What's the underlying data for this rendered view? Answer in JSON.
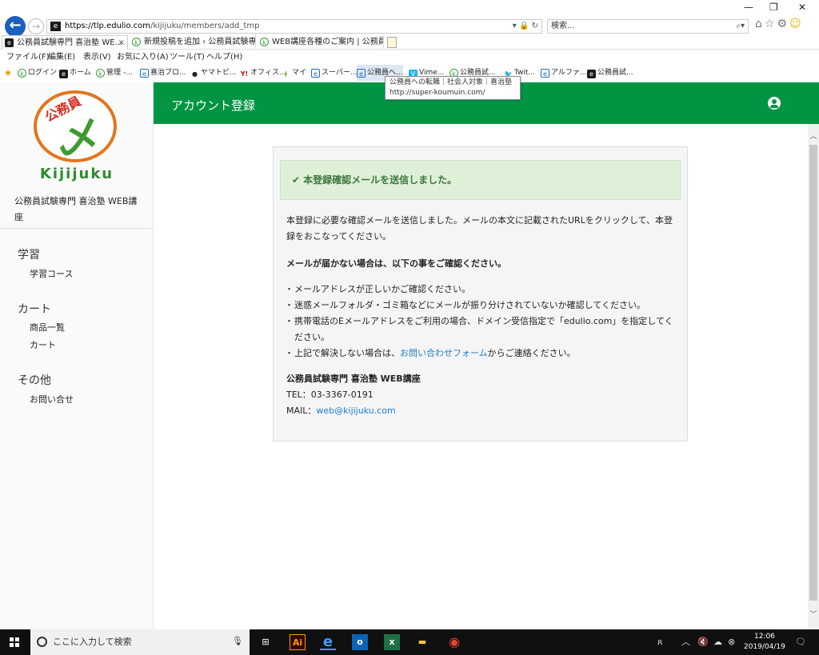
{
  "browser": {
    "url_host": "https://tlp.edulio.com",
    "url_path": "/kijijuku/members/add_tmp",
    "search_placeholder": "検索...",
    "tabs": [
      {
        "label": "公務員試験専門 喜治塾 WE...",
        "close": "×"
      },
      {
        "label": "新規投稿を追加 ‹ 公務員試験専..."
      },
      {
        "label": "WEB講座各種のご案内 | 公務員..."
      }
    ],
    "menu": [
      "ファイル(F)",
      "編集(E)",
      "表示(V)",
      "お気に入り(A)",
      "ツール(T)",
      "ヘルプ(H)"
    ],
    "favorites": [
      "ログイン",
      "ホーム",
      "管理 -...",
      "喜治ブロ...",
      "ヤマトビ...",
      "オフィス...",
      "マイ",
      "スーパー...",
      "公務員へ...",
      "Vime...",
      "公務員試...",
      "Twit...",
      "アルファ...",
      "公務員試..."
    ],
    "tooltip": {
      "line1": "公務員への転職｜社会人対象｜喜治塾",
      "line2": "http://super-koumuin.com/"
    }
  },
  "sidebar": {
    "brand": "Kijijuku",
    "logo_text": "公務員",
    "site_name": "公務員試験専門 喜治塾 WEB講座",
    "sections": [
      {
        "title": "学習",
        "links": [
          "学習コース"
        ]
      },
      {
        "title": "カート",
        "links": [
          "商品一覧",
          "カート"
        ]
      },
      {
        "title": "その他",
        "links": [
          "お問い合せ"
        ]
      }
    ]
  },
  "header": {
    "title": "アカウント登録"
  },
  "main": {
    "alert": "本登録確認メールを送信しました。",
    "intro": "本登録に必要な確認メールを送信しました。メールの本文に記載されたURLをクリックして、本登録をおこなってください。",
    "notice_heading": "メールが届かない場合は、以下の事をご確認ください。",
    "notes": [
      "メールアドレスが正しいかご確認ください。",
      "迷惑メールフォルダ・ゴミ箱などにメールが振り分けされていないか確認してください。",
      "携帯電話のEメールアドレスをご利用の場合、ドメイン受信指定で「edulio.com」を指定してください。"
    ],
    "note_last_pre": "上記で解決しない場合は、",
    "note_last_link": "お問い合わせフォーム",
    "note_last_post": "からご連絡ください。",
    "contact_name": "公務員試験専門 喜治塾 WEB講座",
    "tel": "TEL：03-3367-0191",
    "mail_label": "MAIL：",
    "mail": "web@kijijuku.com"
  },
  "taskbar": {
    "search_placeholder": "ここに入力して検索",
    "time": "12:06",
    "date": "2019/04/19"
  },
  "colors": {
    "brand_green": "#009443",
    "alert_bg": "#dff0d8",
    "link": "#1a7fd6",
    "logo_orange": "#e2761e"
  }
}
